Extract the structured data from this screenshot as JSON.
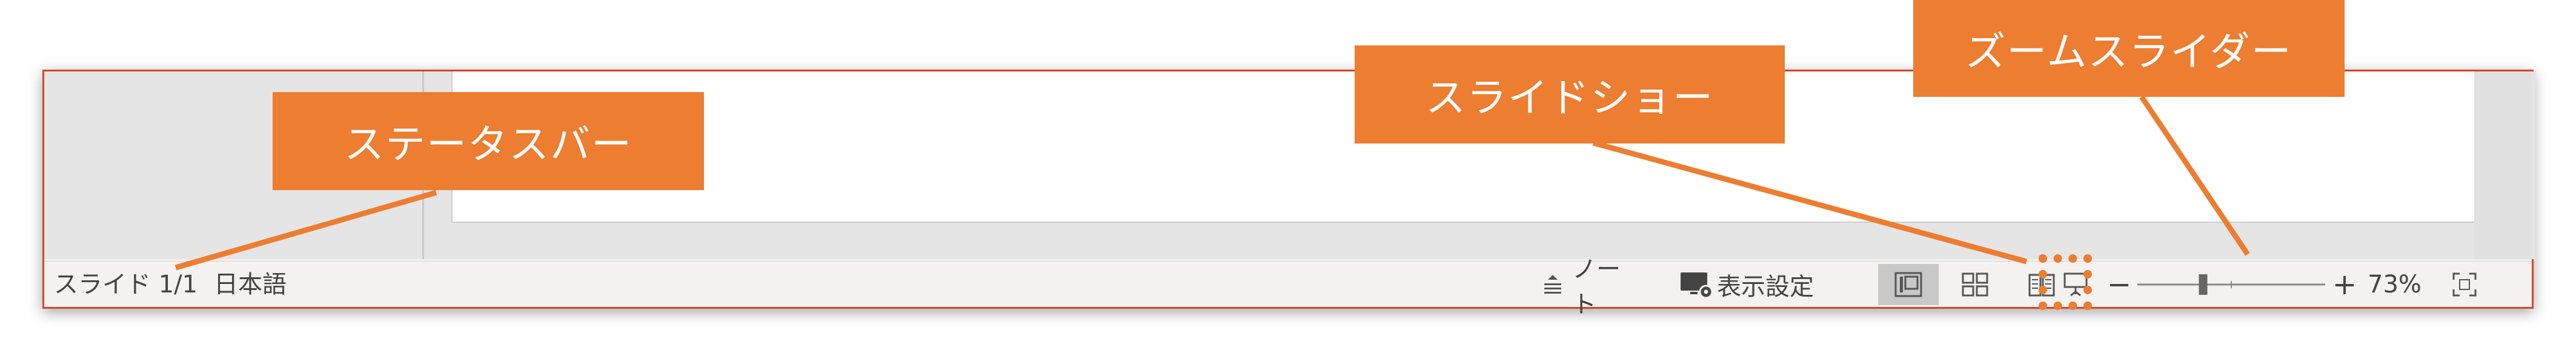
{
  "statusbar": {
    "slide_indicator": "スライド 1/1",
    "language": "日本語",
    "notes_label": "ノート",
    "display_settings_label": "表示設定",
    "zoom_minus": "−",
    "zoom_plus": "+",
    "zoom_percent": "73%",
    "zoom_level": 0.73,
    "views": [
      "normal-view",
      "slide-sorter-view",
      "reading-view",
      "slideshow-view"
    ],
    "active_view": "normal-view"
  },
  "annotations": {
    "statusbar_label": "ステータスバー",
    "slideshow_label": "スライドショー",
    "zoom_slider_label": "ズームスライダー"
  },
  "colors": {
    "accent": "#ed7d31",
    "window_border": "#d24726",
    "statusbar_bg": "#f3f2f1"
  }
}
